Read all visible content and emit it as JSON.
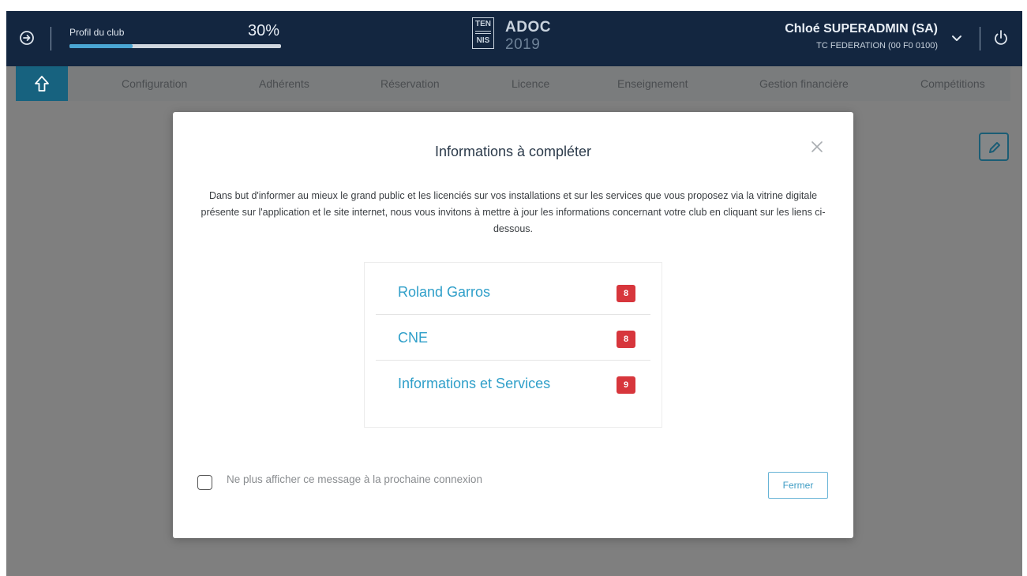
{
  "header": {
    "progress_label": "Profil du club",
    "progress_pct": "30%",
    "progress_value": 0.3,
    "logo_top": "TEN",
    "logo_bottom": "NIS",
    "app_name": "ADOC",
    "app_year": "2019",
    "user_name": "Chloé SUPERADMIN (SA)",
    "user_club": "TC FEDERATION (00 F0 0100)",
    "icons": {
      "login": "login-circle-arrow-icon",
      "dropdown": "chevron-down-icon",
      "logout": "power-icon"
    }
  },
  "nav": {
    "items": [
      {
        "label": "Configuration"
      },
      {
        "label": "Adhérents"
      },
      {
        "label": "Réservation"
      },
      {
        "label": "Licence"
      },
      {
        "label": "Enseignement"
      },
      {
        "label": "Gestion financière"
      },
      {
        "label": "Compétitions"
      }
    ],
    "home_icon": "home-arrow-up-icon"
  },
  "modal": {
    "title": "Informations à compléter",
    "description": "Dans but d'informer au mieux le grand public et les licenciés sur vos installations et sur les services que vous proposez via la vitrine digitale présente sur l'application et le site internet, nous vous invitons à mettre à jour les informations concernant votre club en cliquant sur les liens ci-dessous.",
    "links": [
      {
        "label": "Roland Garros",
        "count": "8"
      },
      {
        "label": "CNE",
        "count": "8"
      },
      {
        "label": "Informations et Services",
        "count": "9"
      }
    ],
    "checkbox_label": "Ne plus afficher ce message à la prochaine connexion",
    "close_button": "Fermer"
  },
  "colors": {
    "header_bg": "#132640",
    "accent": "#2f9fc9",
    "badge": "#d7363c",
    "home_tab": "#17627f"
  }
}
